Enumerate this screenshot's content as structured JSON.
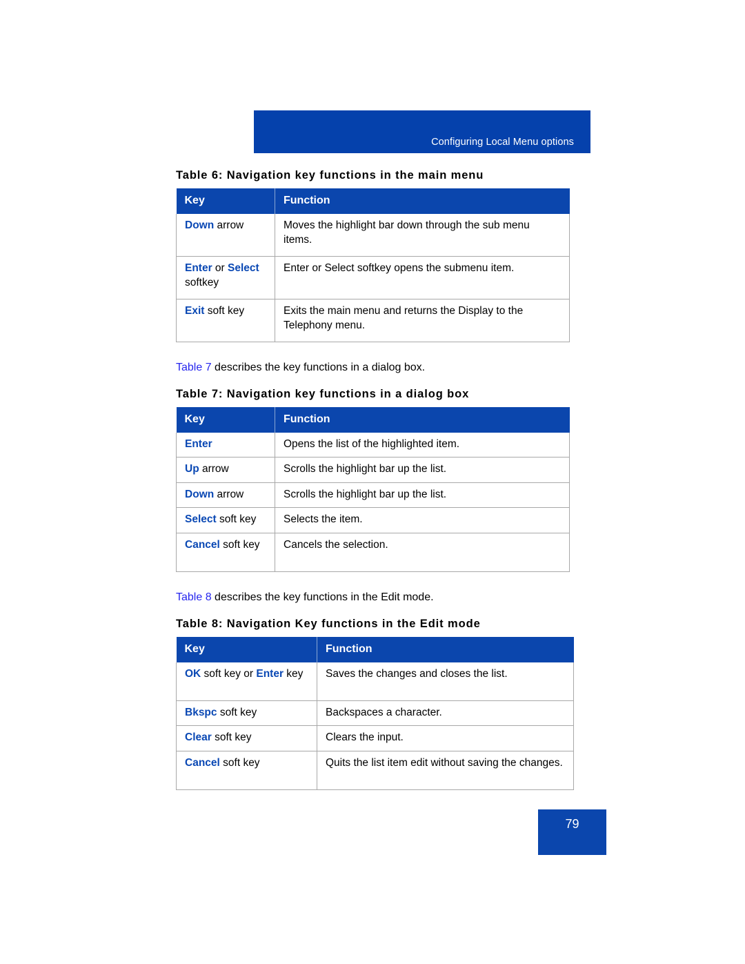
{
  "header": {
    "running_title": "Configuring Local Menu options"
  },
  "footer": {
    "page_number": "79"
  },
  "colors": {
    "header_bar_blue": "#0541AC",
    "table_header_blue": "#0B46AD",
    "key_text_blue": "#0A48B4",
    "xref_blue": "#2626EE",
    "rule_gray": "#a8a8a8"
  },
  "columns": {
    "key": "Key",
    "function": "Function"
  },
  "table6": {
    "caption": "Table 6: Navigation key functions in the main menu",
    "rows": [
      {
        "key_bold": "Down",
        "key_rest": " arrow",
        "function": "Moves the highlight bar down through the sub menu items."
      },
      {
        "key_bold": "Enter",
        "key_mid": " or ",
        "key_bold2": "Select",
        "key_rest": " softkey",
        "function": "Enter or Select softkey opens the submenu item."
      },
      {
        "key_bold": "Exit",
        "key_rest": " soft key",
        "function": "Exits the main menu and returns the Display to the Telephony menu."
      }
    ]
  },
  "intro7": {
    "xref": "Table 7",
    "rest": " describes the key functions in a dialog box."
  },
  "table7": {
    "caption": "Table 7: Navigation key functions in a dialog box",
    "rows": [
      {
        "key_bold": "Enter",
        "key_rest": "",
        "function": "Opens the list of the highlighted item."
      },
      {
        "key_bold": "Up",
        "key_rest": " arrow",
        "function": "Scrolls the highlight bar up the list."
      },
      {
        "key_bold": "Down",
        "key_rest": " arrow",
        "function": "Scrolls the highlight bar up the list."
      },
      {
        "key_bold": "Select",
        "key_rest": " soft key",
        "function": "Selects the item."
      },
      {
        "key_bold": "Cancel",
        "key_rest": " soft key",
        "function": "Cancels the selection."
      }
    ]
  },
  "intro8": {
    "xref": "Table 8",
    "rest": " describes the key functions in the Edit mode."
  },
  "table8": {
    "caption": "Table 8: Navigation Key functions in the Edit mode",
    "rows": [
      {
        "key_bold": "OK",
        "key_mid": " soft key or ",
        "key_bold2": "Enter",
        "key_rest": " key",
        "function": "Saves the changes and closes the list."
      },
      {
        "key_bold": "Bkspc",
        "key_rest": " soft key",
        "function": "Backspaces a character."
      },
      {
        "key_bold": "Clear",
        "key_rest": " soft key",
        "function": "Clears the input."
      },
      {
        "key_bold": "Cancel",
        "key_rest": " soft key",
        "function": "Quits the list item edit without saving the changes."
      }
    ]
  }
}
